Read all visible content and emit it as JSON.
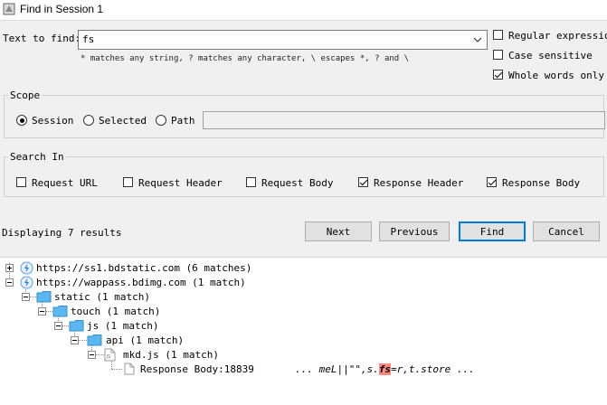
{
  "window": {
    "title": "Find in Session 1"
  },
  "search": {
    "label": "Text to find:",
    "value": "fs",
    "hint": "* matches any string, ? matches any character, \\ escapes *, ? and \\"
  },
  "options": {
    "regex": {
      "label": "Regular expression",
      "checked": false
    },
    "case": {
      "label": "Case sensitive",
      "checked": false
    },
    "whole": {
      "label": "Whole words only",
      "checked": true
    }
  },
  "scope": {
    "title": "Scope",
    "session": "Session",
    "selected": "Selected",
    "path": "Path",
    "selected_value": "Session"
  },
  "search_in": {
    "title": "Search In",
    "request_url": "Request URL",
    "request_header": "Request Header",
    "request_body": "Request Body",
    "response_header": "Response Header",
    "response_body": "Response Body"
  },
  "status": {
    "text": "Displaying 7 results"
  },
  "buttons": {
    "next": "Next",
    "previous": "Previous",
    "find": "Find",
    "cancel": "Cancel"
  },
  "results": {
    "host1": "https://ss1.bdstatic.com (6 matches)",
    "host2": "https://wappass.bdimg.com (1 match)",
    "static": "static (1 match)",
    "touch": "touch (1 match)",
    "js": "js (1 match)",
    "api": "api (1 match)",
    "file": "mkd.js (1 match)",
    "match_label": "Response Body:18839",
    "match_pre": "...  meL||\"\",s.",
    "match_hit": "fs",
    "match_post": "=r,t.store  ..."
  },
  "colors": {
    "folder": "#5bb7f0",
    "highlight": "#ff8a80",
    "find_border": "#0078d7"
  }
}
